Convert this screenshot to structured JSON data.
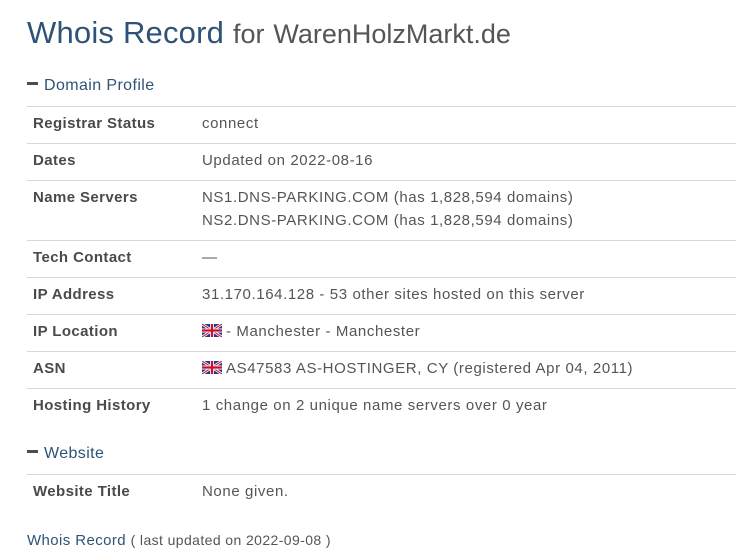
{
  "header": {
    "title_main": "Whois Record",
    "title_for": "for",
    "domain": "WarenHolzMarkt.de"
  },
  "sections": {
    "domain_profile": {
      "heading": "Domain Profile",
      "rows": {
        "registrar_status": {
          "key": "Registrar Status",
          "value": "connect"
        },
        "dates": {
          "key": "Dates",
          "value": "Updated on 2022-08-16"
        },
        "name_servers": {
          "key": "Name Servers",
          "value_1": "NS1.DNS-PARKING.COM (has 1,828,594 domains)",
          "value_2": "NS2.DNS-PARKING.COM (has 1,828,594 domains)"
        },
        "tech_contact": {
          "key": "Tech Contact",
          "value": "—"
        },
        "ip_address": {
          "key": "IP Address",
          "value": "31.170.164.128 - 53 other sites hosted on this server"
        },
        "ip_location": {
          "key": "IP Location",
          "value": "- Manchester - Manchester",
          "flag_icon": "uk-flag-icon"
        },
        "asn": {
          "key": "ASN",
          "value": "AS47583 AS-HOSTINGER, CY (registered Apr 04, 2011)",
          "flag_icon": "uk-flag-icon"
        },
        "hosting_history": {
          "key": "Hosting History",
          "value": "1 change on 2 unique name servers over 0 year"
        }
      }
    },
    "website": {
      "heading": "Website",
      "rows": {
        "website_title": {
          "key": "Website Title",
          "value": "None given."
        }
      }
    }
  },
  "footer": {
    "link_label": "Whois Record",
    "note": "( last updated on 2022-09-08 )"
  },
  "colors": {
    "accent": "#2e5377",
    "text": "#4d4d4d",
    "divider": "#d6d6d6"
  }
}
